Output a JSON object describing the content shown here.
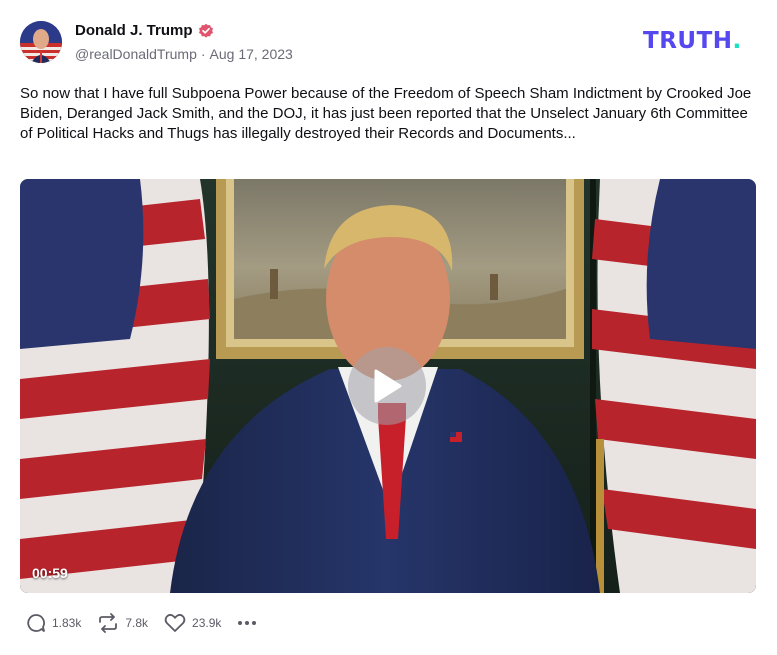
{
  "author": {
    "display_name": "Donald J. Trump",
    "handle": "@realDonaldTrump",
    "separator": "·",
    "date": "Aug 17, 2023",
    "verified": true
  },
  "brand": {
    "logo_text": "TRUTH",
    "logo_dot": ".",
    "color_primary": "#5448ee",
    "color_accent": "#17e0c4"
  },
  "post": {
    "text": "So now that I have full Subpoena Power because of the Freedom of Speech Sham Indictment by Crooked Joe Biden, Deranged Jack Smith, and the DOJ, it has just been reported that the Unselect January 6th Committee of Political Hacks and Thugs has illegally destroyed their Records and Documents..."
  },
  "video": {
    "duration": "00:59",
    "play_icon": "play-icon"
  },
  "actions": {
    "replies": "1.83k",
    "retruths": "7.8k",
    "likes": "23.9k",
    "reply_icon": "reply-icon",
    "retruth_icon": "retruth-icon",
    "like_icon": "heart-icon",
    "more_icon": "more-icon"
  }
}
